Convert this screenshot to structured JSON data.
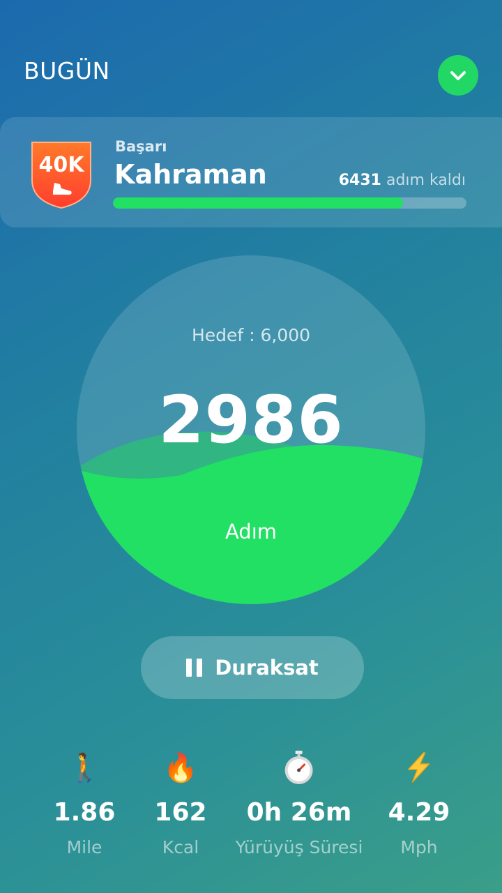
{
  "header": {
    "title": "BUGÜN"
  },
  "achievement": {
    "badge_text": "40K",
    "subtitle": "Başarı",
    "name": "Kahraman",
    "remaining_count": "6431",
    "remaining_text": "adım kaldı",
    "progress_fraction": 0.82
  },
  "steps": {
    "goal_label": "Hedef : 6,000",
    "count": "2986",
    "unit": "Adım",
    "fill_fraction": 0.5
  },
  "controls": {
    "pause_label": "Duraksat"
  },
  "stats": [
    {
      "icon": "walking-person-icon",
      "glyph": "🚶",
      "value": "1.86",
      "label": "Mile"
    },
    {
      "icon": "fire-icon",
      "glyph": "🔥",
      "value": "162",
      "label": "Kcal"
    },
    {
      "icon": "stopwatch-icon",
      "glyph": "⏱",
      "value": "0h 26m",
      "label": "Yürüyüş Süresi"
    },
    {
      "icon": "lightning-icon",
      "glyph": "⚡",
      "value": "4.29",
      "label": "Mph"
    }
  ],
  "colors": {
    "accent_green": "#22d865",
    "badge_orange": "#ff5a2a"
  }
}
